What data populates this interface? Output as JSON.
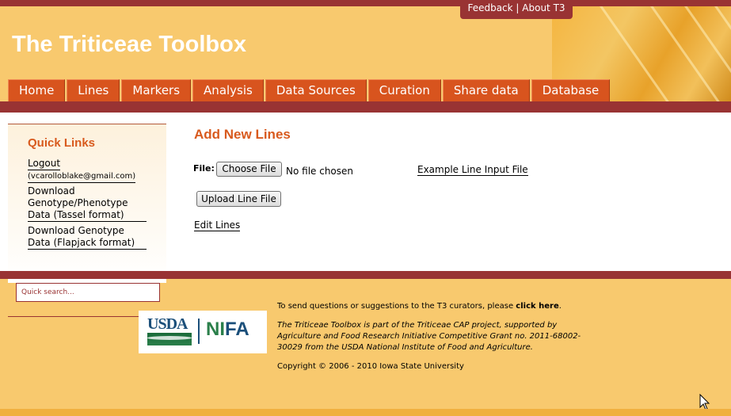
{
  "header": {
    "site_title": "The Triticeae Toolbox",
    "feedback_label": "Feedback",
    "about_label": "About T3"
  },
  "nav": {
    "tabs": [
      {
        "label": "Home"
      },
      {
        "label": "Lines"
      },
      {
        "label": "Markers"
      },
      {
        "label": "Analysis"
      },
      {
        "label": "Data Sources"
      },
      {
        "label": "Curation"
      },
      {
        "label": "Share data"
      },
      {
        "label": "Database"
      }
    ]
  },
  "sidebar": {
    "title": "Quick Links",
    "logout_label": "Logout",
    "user_email": "(vcarolloblake@gmail.com)",
    "link_tassel": "Download Genotype/Phenotype Data (Tassel format)",
    "link_flapjack": "Download Genotype Data (Flapjack format)",
    "search_placeholder": "Quick search..."
  },
  "main": {
    "heading": "Add New Lines",
    "file_label": "File:",
    "choose_file_label": "Choose File",
    "no_file_text": "No file chosen",
    "example_link": "Example Line Input File",
    "upload_label": "Upload Line File",
    "edit_link": "Edit Lines"
  },
  "footer": {
    "contact_prefix": "To send questions or suggestions to the T3 curators, please ",
    "contact_link": "click here",
    "contact_suffix": ".",
    "project_text": "The Triticeae Toolbox is part of the Triticeae CAP project, supported by Agriculture and Food Research Initiative Competitive Grant no. 2011-68002-30029 from the USDA National Institute of Food and Agriculture.",
    "copyright": "Copyright © 2006 - 2010 Iowa State University",
    "logo_usda": "USDA",
    "logo_nifa_ni": "NI",
    "logo_nifa_fa": "FA"
  },
  "colors": {
    "brand_red": "#993333",
    "tab_orange": "#d8541e",
    "heading_orange": "#d85a1e",
    "background": "#f8c96e"
  }
}
